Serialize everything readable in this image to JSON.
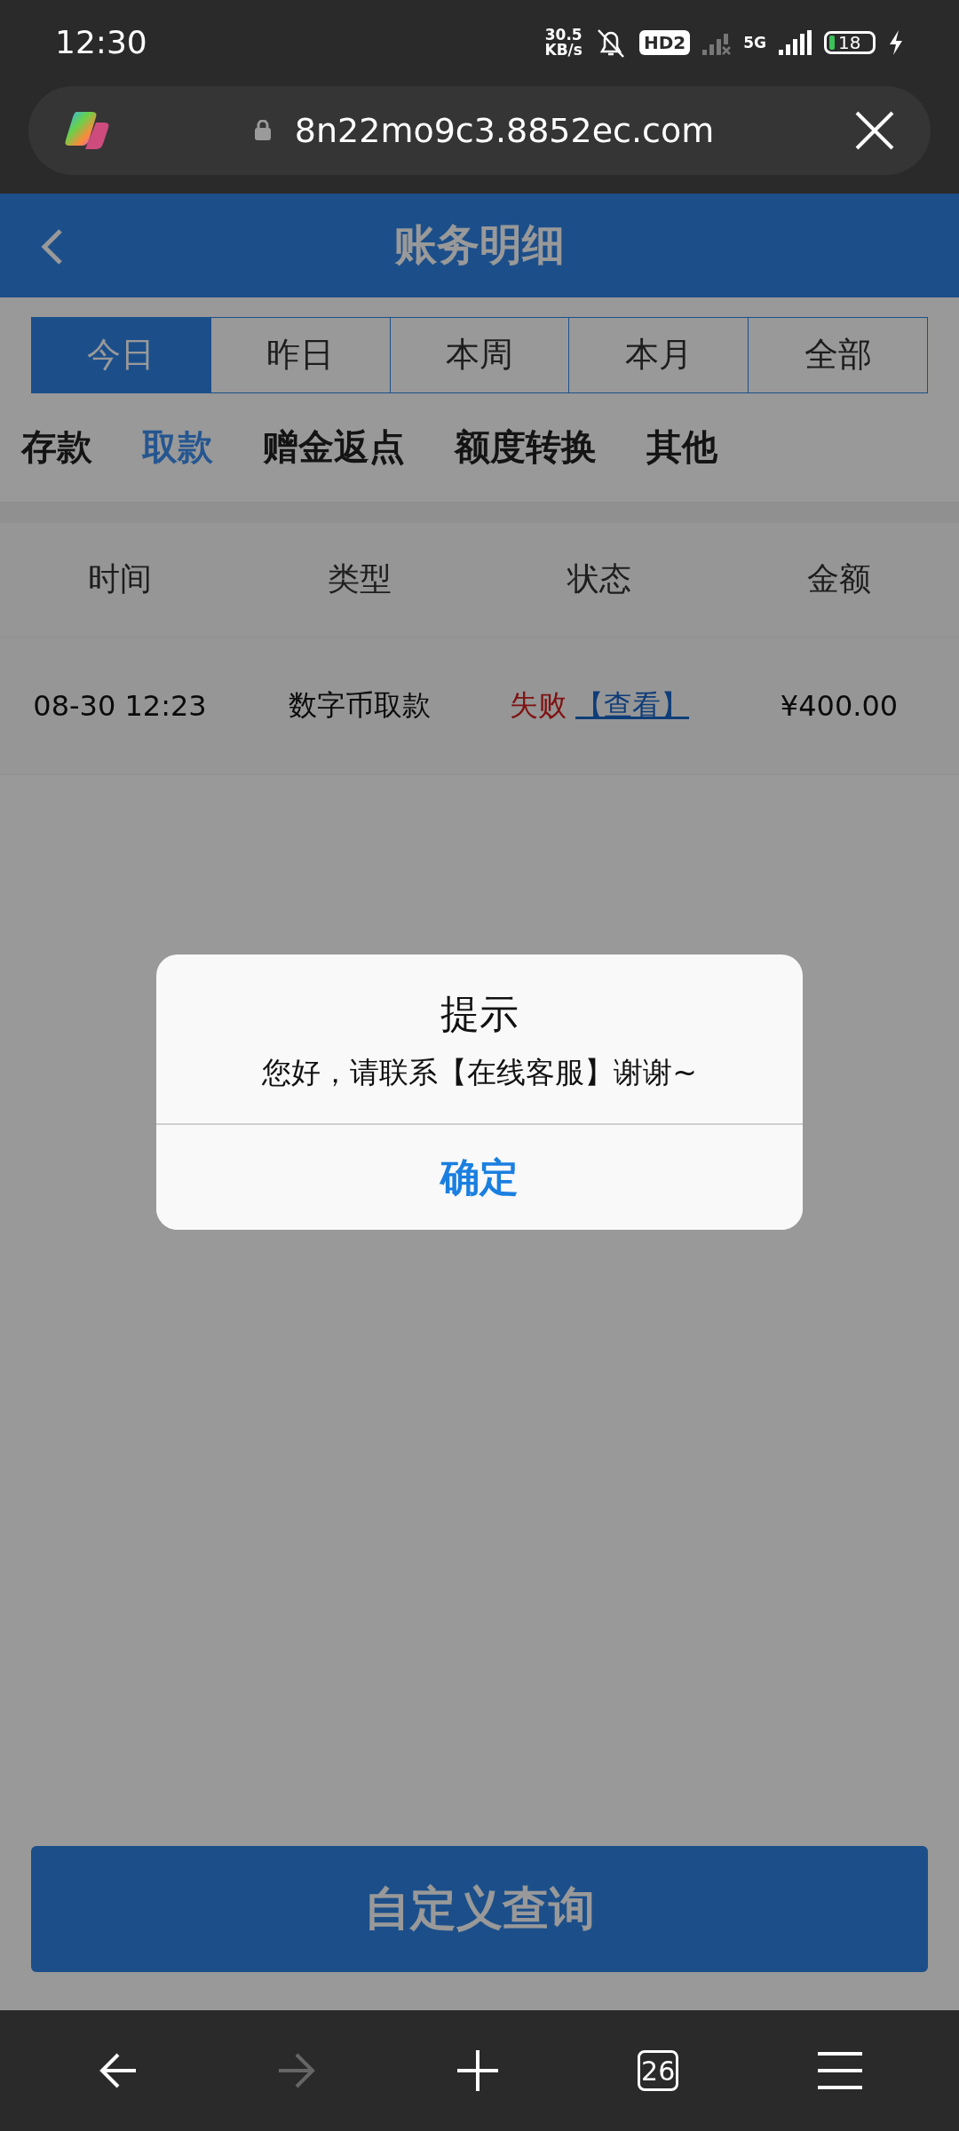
{
  "status_bar": {
    "time": "12:30",
    "speed_value": "30.5",
    "speed_unit": "KB/s",
    "hd_badge": "HD2",
    "network": "5G",
    "battery": "18"
  },
  "address_bar": {
    "url": "8n22mo9c3.8852ec.com"
  },
  "header": {
    "title": "账务明细"
  },
  "period_tabs": [
    {
      "label": "今日",
      "selected": true
    },
    {
      "label": "昨日",
      "selected": false
    },
    {
      "label": "本周",
      "selected": false
    },
    {
      "label": "本月",
      "selected": false
    },
    {
      "label": "全部",
      "selected": false
    }
  ],
  "category_tabs": [
    {
      "label": "存款",
      "selected": false
    },
    {
      "label": "取款",
      "selected": true
    },
    {
      "label": "赠金返点",
      "selected": false
    },
    {
      "label": "额度转换",
      "selected": false
    },
    {
      "label": "其他",
      "selected": false
    }
  ],
  "table": {
    "columns": [
      "时间",
      "类型",
      "状态",
      "金额"
    ],
    "rows": [
      {
        "time": "08-30 12:23",
        "type": "数字币取款",
        "status": "失败",
        "action": "【查看】",
        "amount": "¥400.00"
      }
    ]
  },
  "dialog": {
    "title": "提示",
    "message": "您好，请联系【在线客服】谢谢~",
    "button": "确定"
  },
  "query_button": {
    "label": "自定义查询"
  },
  "browser_nav": {
    "tab_count": "26"
  }
}
